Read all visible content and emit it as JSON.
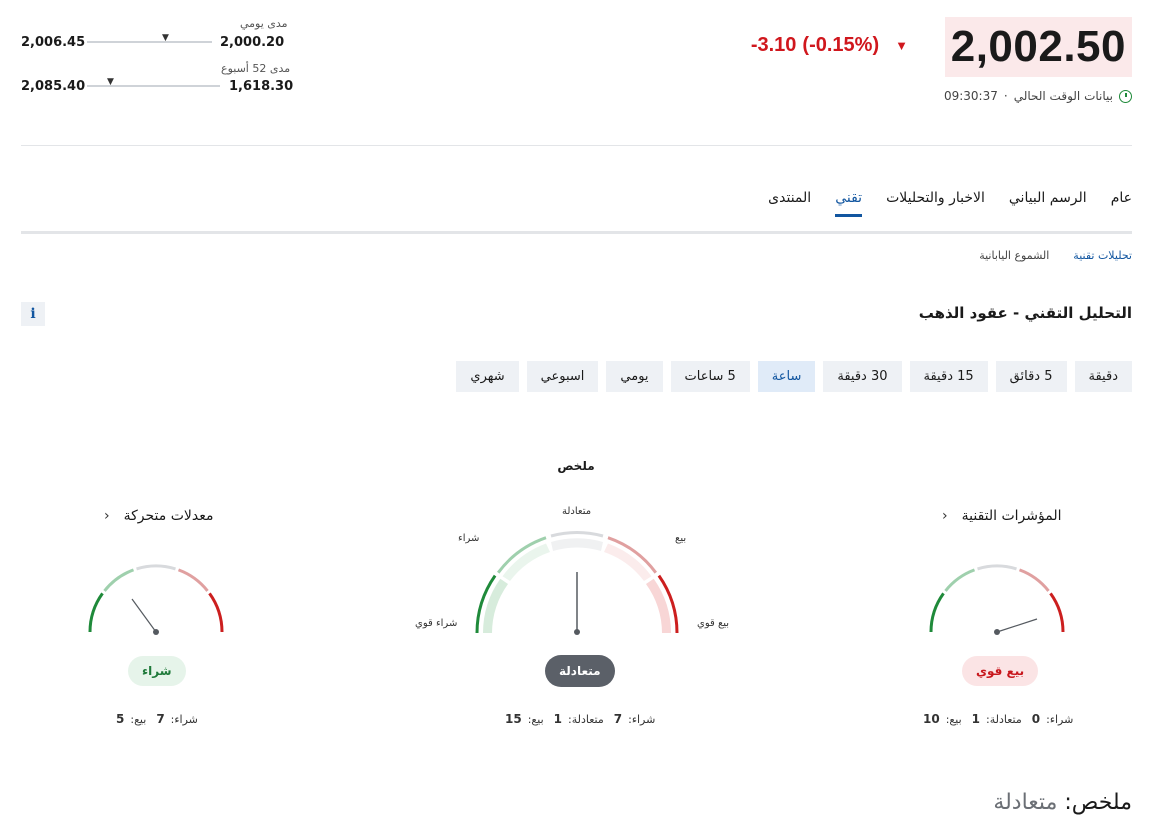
{
  "header": {
    "price": "2,002.50",
    "change": "-3.10",
    "change_pct": "(-0.15%)",
    "change_color": "#d0171d",
    "time": "09:30:37",
    "time_separator": "·",
    "time_label": "بيانات الوقت الحالي",
    "daily_range": {
      "title": "مدى يومي",
      "low": "2,000.20",
      "high": "2,006.45"
    },
    "week52_range": {
      "title": "مدى 52 أسبوع",
      "low": "1,618.30",
      "high": "2,085.40"
    }
  },
  "tabs": [
    "عام",
    "الرسم البياني",
    "الاخبار والتحليلات",
    "تقني",
    "المنتدى"
  ],
  "active_tab": "تقني",
  "subtabs": [
    "تحليلات تقنية",
    "الشموع اليابانية"
  ],
  "section_title": "التحليل التقني - عقود الذهب",
  "info_icon": "i",
  "periods": [
    "دقيقة",
    "5 دقائق",
    "15 دقيقة",
    "30 دقيقة",
    "ساعة",
    "5 ساعات",
    "يومي",
    "اسبوعي",
    "شهري"
  ],
  "active_period": "ساعة",
  "summary_label": "ملخص",
  "gauges": {
    "moving_averages": {
      "title": "معدلات متحركة",
      "chevron": "‹",
      "verdict": "شراء",
      "buy_label": "شراء:",
      "buy": "7",
      "sell_label": "بيع:",
      "sell": "5"
    },
    "summary": {
      "verdict": "متعادلة",
      "buy_label": "شراء:",
      "buy": "7",
      "neutral_label": "متعادلة:",
      "neutral": "1",
      "sell_label": "بيع:",
      "sell": "15",
      "labels": {
        "strong_buy": "شراء قوي",
        "buy": "شراء",
        "neutral": "متعادلة",
        "sell": "بيع",
        "strong_sell": "بيع قوي"
      }
    },
    "indicators": {
      "title": "المؤشرات التقنية",
      "chevron": "‹",
      "verdict": "بيع قوي",
      "buy_label": "شراء:",
      "buy": "0",
      "neutral_label": "متعادلة:",
      "neutral": "1",
      "sell_label": "بيع:",
      "sell": "10"
    }
  },
  "bottom_summary": {
    "label": "ملخص:",
    "value": "متعادلة"
  },
  "colors": {
    "accent": "#1256a0",
    "buy": "#1f7a3a",
    "sell": "#c8171d",
    "neutral_pill": "#5b6068"
  }
}
